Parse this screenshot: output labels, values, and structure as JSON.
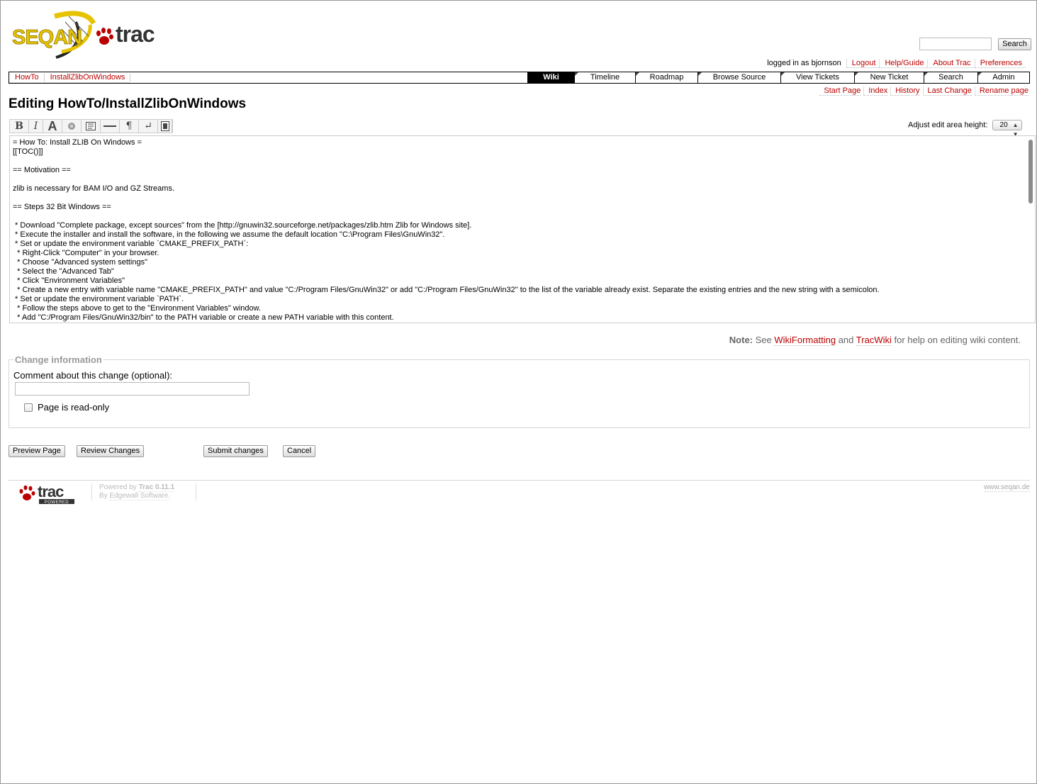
{
  "logo": {
    "brand": "SEQAN",
    "product": "trac"
  },
  "search": {
    "value": "",
    "button_label": "Search"
  },
  "metanav": {
    "logged_in": "logged in as bjornson",
    "links": [
      "Logout",
      "Help/Guide",
      "About Trac",
      "Preferences"
    ]
  },
  "breadcrumbs": [
    "HowTo",
    "InstallZlibOnWindows"
  ],
  "mainnav": [
    "Wiki",
    "Timeline",
    "Roadmap",
    "Browse Source",
    "View Tickets",
    "New Ticket",
    "Search",
    "Admin"
  ],
  "mainnav_active": "Wiki",
  "ctxtnav": [
    "Start Page",
    "Index",
    "History",
    "Last Change",
    "Rename page"
  ],
  "page_title": "Editing HowTo/InstallZlibOnWindows",
  "toolbar": {
    "buttons": [
      "bold",
      "italic",
      "heading",
      "link",
      "code-block",
      "horizontal-rule",
      "paragraph",
      "line-break",
      "image"
    ]
  },
  "adjust": {
    "label": "Adjust edit area height:",
    "value": "20"
  },
  "editor": {
    "lines": [
      "= How To: Install ZLIB On Windows =",
      "[[TOC()]]",
      "",
      "== Motivation ==",
      "",
      "zlib is necessary for BAM I/O and GZ Streams.",
      "",
      "== Steps 32 Bit Windows ==",
      "",
      " * Download \"Complete package, except sources\" from the [http://gnuwin32.sourceforge.net/packages/zlib.htm Zlib for Windows site].",
      " * Execute the installer and install the software, in the following we assume the default location \"C:\\Program Files\\GnuWin32\".",
      " * Set or update the environment variable `CMAKE_PREFIX_PATH`:",
      "  * Right-Click \"Computer\" in your browser.",
      "  * Choose \"Advanced system settings\"",
      "  * Select the \"Advanced Tab\"",
      "  * Click \"Environment Variables\"",
      "  * Create a new entry with variable name \"CMAKE_PREFIX_PATH\" and value \"C:/Program Files/GnuWin32\" or add \"C:/Program Files/GnuWin32\" to the list of the variable already exist. Separate the existing entries and the new string with a semicolon.",
      " * Set or update the environment variable `PATH`.",
      "  * Follow the steps above to get to the \"Environment Variables\" window.",
      "  * Add \"C:/Program Files/GnuWin32/bin\" to the PATH variable or create a new PATH variable with this content."
    ]
  },
  "note": {
    "label": "Note:",
    "text_1": "See",
    "link_1": "WikiFormatting",
    "text_2": "and",
    "link_2": "TracWiki",
    "text_3": "for help on editing wiki content."
  },
  "change_info": {
    "legend": "Change information",
    "comment_label": "Comment about this change (optional):",
    "comment_value": "",
    "readonly_label": "Page is read-only",
    "readonly_checked": false
  },
  "buttons": {
    "preview": "Preview Page",
    "review": "Review Changes",
    "submit": "Submit changes",
    "cancel": "Cancel"
  },
  "footer": {
    "powered_by": "Powered by",
    "trac_version": "Trac 0.11.1",
    "by": "By",
    "edgewall": "Edgewall Software.",
    "site": "www.seqan.de",
    "logo_text": "trac",
    "logo_badge": "POWERED"
  }
}
